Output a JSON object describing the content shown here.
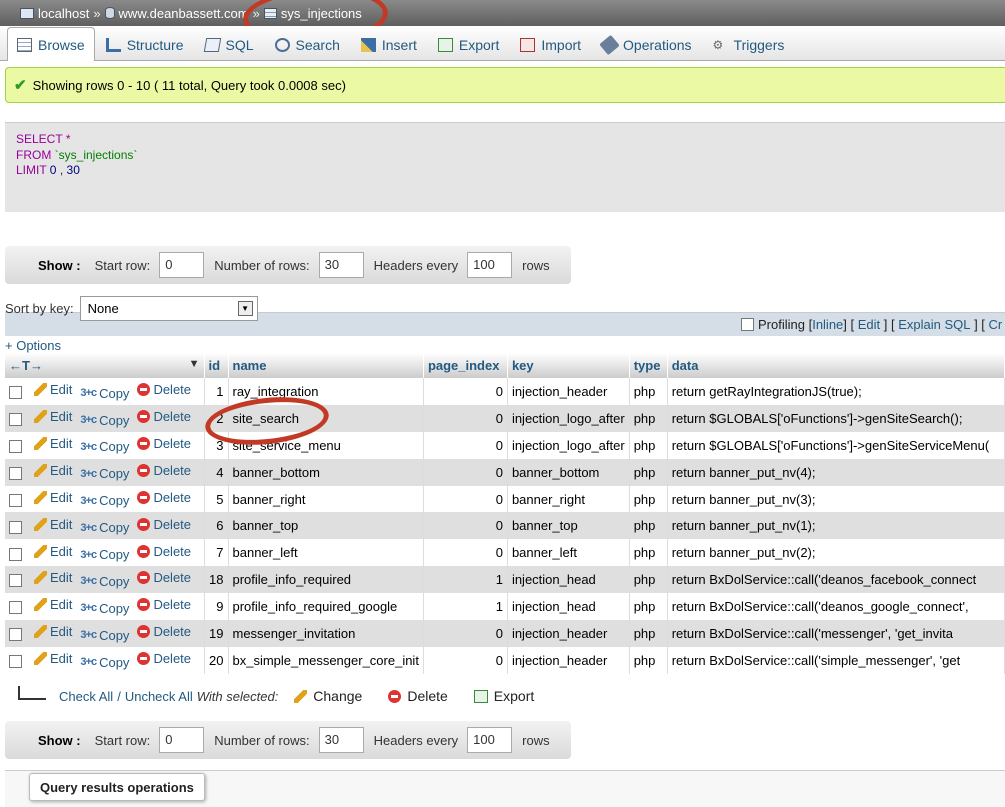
{
  "breadcrumb": {
    "server": "localhost",
    "database": "www.deanbassett.com",
    "table": "sys_injections",
    "separator": "»"
  },
  "tabs": [
    {
      "label": "Browse",
      "icon": "browse-icon",
      "active": true
    },
    {
      "label": "Structure",
      "icon": "structure-icon"
    },
    {
      "label": "SQL",
      "icon": "sql-icon"
    },
    {
      "label": "Search",
      "icon": "search-icon"
    },
    {
      "label": "Insert",
      "icon": "insert-icon"
    },
    {
      "label": "Export",
      "icon": "export-icon"
    },
    {
      "label": "Import",
      "icon": "import-icon"
    },
    {
      "label": "Operations",
      "icon": "wrench-icon"
    },
    {
      "label": "Triggers",
      "icon": "triggers-icon"
    }
  ],
  "success_message": "Showing rows 0 - 10 ( 11 total, Query took 0.0008 sec)",
  "sql": {
    "select_kw": "SELECT",
    "star": "*",
    "from_kw": "FROM",
    "table": "`sys_injections`",
    "limit_kw": "LIMIT",
    "limit_a": "0",
    "comma": ",",
    "limit_b": "30"
  },
  "profiling": {
    "label": "Profiling",
    "inline": "Inline",
    "edit": "Edit",
    "explain": "Explain SQL",
    "cut": "Cr"
  },
  "show_bar": {
    "show_label": "Show :",
    "start_row_label": "Start row:",
    "start_row": "0",
    "num_rows_label": "Number of rows:",
    "num_rows": "30",
    "headers_every_label": "Headers every",
    "headers_every": "100",
    "rows_label": "rows"
  },
  "sort": {
    "label": "Sort by key:",
    "value": "None"
  },
  "options_link": "+ Options",
  "table": {
    "arrows": "←T→",
    "columns": [
      "id",
      "name",
      "page_index",
      "key",
      "type",
      "data"
    ],
    "action_labels": {
      "edit": "Edit",
      "copy": "Copy",
      "delete": "Delete"
    },
    "rows": [
      {
        "id": "1",
        "name": "ray_integration",
        "page_index": "0",
        "key": "injection_header",
        "type": "php",
        "data": "return getRayIntegrationJS(true);"
      },
      {
        "id": "2",
        "name": "site_search",
        "page_index": "0",
        "key": "injection_logo_after",
        "type": "php",
        "data": "return $GLOBALS['oFunctions']->genSiteSearch();"
      },
      {
        "id": "3",
        "name": "site_service_menu",
        "page_index": "0",
        "key": "injection_logo_after",
        "type": "php",
        "data": "return $GLOBALS['oFunctions']->genSiteServiceMenu("
      },
      {
        "id": "4",
        "name": "banner_bottom",
        "page_index": "0",
        "key": "banner_bottom",
        "type": "php",
        "data": "return banner_put_nv(4);"
      },
      {
        "id": "5",
        "name": "banner_right",
        "page_index": "0",
        "key": "banner_right",
        "type": "php",
        "data": "return banner_put_nv(3);"
      },
      {
        "id": "6",
        "name": "banner_top",
        "page_index": "0",
        "key": "banner_top",
        "type": "php",
        "data": "return banner_put_nv(1);"
      },
      {
        "id": "7",
        "name": "banner_left",
        "page_index": "0",
        "key": "banner_left",
        "type": "php",
        "data": "return banner_put_nv(2);"
      },
      {
        "id": "18",
        "name": "profile_info_required",
        "page_index": "1",
        "key": "injection_head",
        "type": "php",
        "data": "return BxDolService::call('deanos_facebook_connect"
      },
      {
        "id": "9",
        "name": "profile_info_required_google",
        "page_index": "1",
        "key": "injection_head",
        "type": "php",
        "data": "return BxDolService::call('deanos_google_connect',"
      },
      {
        "id": "19",
        "name": "messenger_invitation",
        "page_index": "0",
        "key": "injection_header",
        "type": "php",
        "data": "return BxDolService::call('messenger', 'get_invita"
      },
      {
        "id": "20",
        "name": "bx_simple_messenger_core_init",
        "page_index": "0",
        "key": "injection_header",
        "type": "php",
        "data": "return BxDolService::call('simple_messenger', 'get"
      }
    ]
  },
  "bulk": {
    "check_all": "Check All",
    "slash": "/",
    "uncheck_all": "Uncheck All",
    "with_selected": "With selected:",
    "change": "Change",
    "delete": "Delete",
    "export": "Export"
  },
  "query_results_operations": "Query results operations",
  "colors": {
    "link": "#235a81",
    "success_bg": "#ebf8a4",
    "annotation": "#c23a25"
  }
}
